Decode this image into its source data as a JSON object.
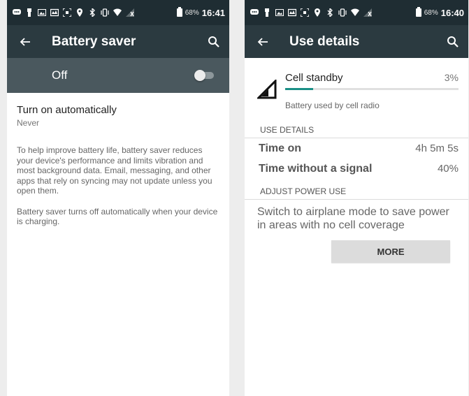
{
  "left": {
    "status_bar": {
      "battery_pct": "68%",
      "time": "16:41"
    },
    "app_bar": {
      "title": "Battery saver"
    },
    "master_switch": {
      "label": "Off",
      "state": "off"
    },
    "auto_pref": {
      "title": "Turn on automatically",
      "summary": "Never"
    },
    "info": [
      "To help improve battery life, battery saver reduces your device's performance and limits vibration and most background data. Email, messaging, and other apps that rely on syncing may not update unless you open them.",
      "Battery saver turns off automatically when your device is charging."
    ]
  },
  "right": {
    "status_bar": {
      "battery_pct": "68%",
      "time": "16:40"
    },
    "app_bar": {
      "title": "Use details"
    },
    "usage": {
      "title": "Cell standby",
      "percent": "3%",
      "progress": 0.03,
      "subtitle": "Battery used by cell radio",
      "accent": "#1b8f86"
    },
    "use_details": {
      "header": "USE DETAILS",
      "rows": [
        {
          "label": "Time on",
          "value": "4h 5m 5s"
        },
        {
          "label": "Time without a signal",
          "value": "40%"
        }
      ]
    },
    "adjust": {
      "header": "ADJUST POWER USE",
      "description": "Switch to airplane mode to save power in areas with no cell coverage",
      "button": "MORE"
    }
  }
}
